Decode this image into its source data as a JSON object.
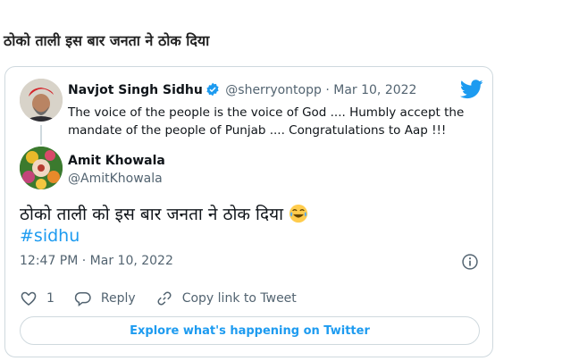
{
  "headline": "ठोको ताली इस बार जनता ने ठोक दिया",
  "quoted": {
    "name": "Navjot Singh Sidhu",
    "handle": "@sherryontopp",
    "separator": "·",
    "date": "Mar 10, 2022",
    "text": "The voice of the people is the voice of God .... Humbly accept the mandate of the people of Punjab .... Congratulations to Aap !!!"
  },
  "author": {
    "name": "Amit Khowala",
    "handle": "@AmitKhowala"
  },
  "tweet": {
    "text": "ठोको ताली को इस बार जनता ने ठोक दिया",
    "hashtag": "#sidhu",
    "timestamp": "12:47 PM · Mar 10, 2022"
  },
  "actions": {
    "like_count": "1",
    "reply_label": "Reply",
    "copy_label": "Copy link to Tweet"
  },
  "explore_label": "Explore what's happening on Twitter",
  "colors": {
    "brand": "#1d9bf0",
    "muted": "#536471",
    "border": "#cfd9de"
  },
  "icons": [
    "twitter-bird-icon",
    "verified-badge-icon",
    "info-icon",
    "heart-icon",
    "reply-icon",
    "link-icon",
    "laughing-emoji-icon"
  ]
}
